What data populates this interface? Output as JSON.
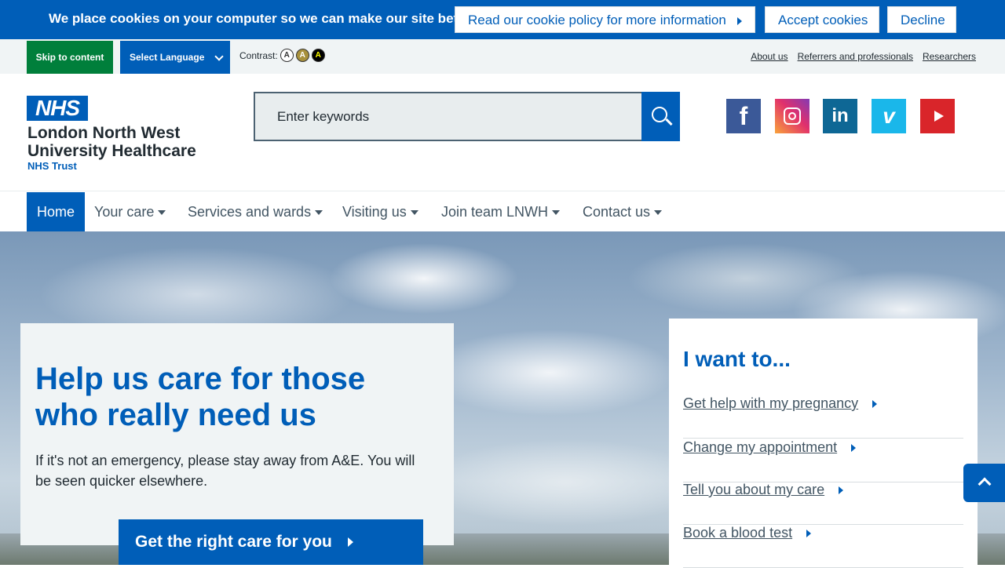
{
  "cookie": {
    "message": "We place cookies on your computer so we can make our site better.",
    "policy_link": "Read our cookie policy for more information",
    "accept": "Accept cookies",
    "decline": "Decline"
  },
  "utility": {
    "skip": "Skip to content",
    "language": "Select Language",
    "contrast_label": "Contrast:",
    "contrast_options": [
      "A",
      "A",
      "A"
    ],
    "links": [
      "About us",
      "Referrers and professionals",
      "Researchers"
    ]
  },
  "header": {
    "logo_text": "NHS",
    "org_line1": "London North West",
    "org_line2": "University Healthcare",
    "org_line3": "NHS Trust",
    "search_placeholder": "Enter keywords",
    "social": {
      "facebook": "f",
      "linkedin": "in",
      "vimeo": "v"
    }
  },
  "nav": {
    "home": "Home",
    "items": [
      "Your care",
      "Services and wards",
      "Visiting us",
      "Join team LNWH",
      "Contact us"
    ]
  },
  "hero": {
    "title": "Help us care for those who really need us",
    "text": "If it's not an emergency, please stay away from A&E. You will be seen quicker elsewhere.",
    "cta": "Get the right care for you"
  },
  "want": {
    "title": "I want to...",
    "items": [
      "Get help with my pregnancy",
      "Change my appointment",
      "Tell you about my care",
      "Book a blood test"
    ]
  },
  "colors": {
    "nhs_blue": "#005eb8",
    "nhs_green": "#007f3b"
  }
}
